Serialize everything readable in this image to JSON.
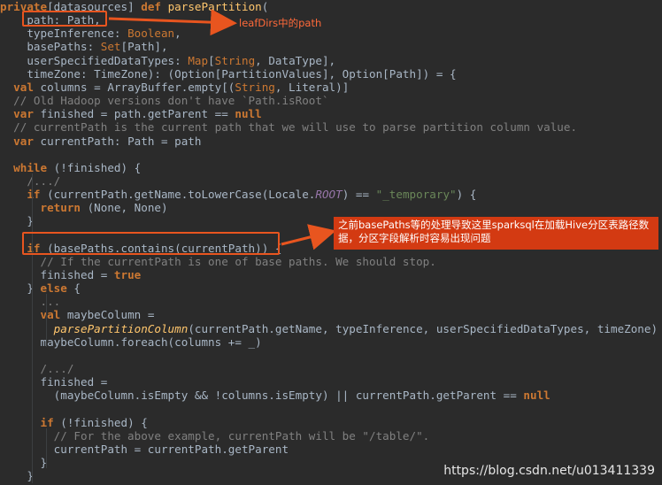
{
  "annotations": {
    "label1": "leafDirs中的path",
    "label2": "之前basePaths等的处理导致这里sparksql在加载Hive分区表路径数据，分区字段解析时容易出现问题"
  },
  "watermark": "https://blog.csdn.net/u013411339",
  "colors": {
    "background": "#2b2b2b",
    "keyword": "#cc7832",
    "comment": "#808080",
    "string": "#6a8759",
    "function": "#ffc66d",
    "constant": "#9876aa",
    "highlight": "#e8551f"
  },
  "code_lines": [
    [
      [
        "kw",
        "private"
      ],
      [
        "plain",
        "["
      ],
      [
        "plain",
        "datasources"
      ],
      [
        "plain",
        "] "
      ],
      [
        "kw",
        "def "
      ],
      [
        "fn2",
        "parsePartition"
      ],
      [
        "plain",
        "("
      ]
    ],
    [
      [
        "plain",
        "    path: Path,"
      ]
    ],
    [
      [
        "plain",
        "    typeInference: "
      ],
      [
        "type",
        "Boolean"
      ],
      [
        "plain",
        ","
      ]
    ],
    [
      [
        "plain",
        "    basePaths: "
      ],
      [
        "type",
        "Set"
      ],
      [
        "plain",
        "[Path],"
      ]
    ],
    [
      [
        "plain",
        "    userSpecifiedDataTypes: "
      ],
      [
        "type",
        "Map"
      ],
      [
        "plain",
        "["
      ],
      [
        "type",
        "String"
      ],
      [
        "plain",
        ", DataType],"
      ]
    ],
    [
      [
        "plain",
        "    timeZone: TimeZone): (Option[PartitionValues], Option[Path]) = {"
      ]
    ],
    [
      [
        "kw",
        "  val "
      ],
      [
        "plain",
        "columns = ArrayBuffer.empty[("
      ],
      [
        "type",
        "String"
      ],
      [
        "plain",
        ", Literal)]"
      ]
    ],
    [
      [
        "com",
        "  // Old Hadoop versions don't have `Path.isRoot`"
      ]
    ],
    [
      [
        "kw",
        "  var "
      ],
      [
        "plain",
        "finished = path.getParent == "
      ],
      [
        "kw",
        "null"
      ]
    ],
    [
      [
        "com",
        "  // currentPath is the current path that we will use to parse partition column value."
      ]
    ],
    [
      [
        "kw",
        "  var "
      ],
      [
        "plain",
        "currentPath: Path = path"
      ]
    ],
    [
      [
        "plain",
        ""
      ]
    ],
    [
      [
        "kw",
        "  while "
      ],
      [
        "plain",
        "(!finished) {"
      ]
    ],
    [
      [
        "com",
        "    /.../"
      ]
    ],
    [
      [
        "kw",
        "    if "
      ],
      [
        "plain",
        "(currentPath.getName.toLowerCase(Locale."
      ],
      [
        "const",
        "ROOT"
      ],
      [
        "plain",
        ") == "
      ],
      [
        "str",
        "\"_temporary\""
      ],
      [
        "plain",
        ") {"
      ]
    ],
    [
      [
        "kw",
        "      return "
      ],
      [
        "plain",
        "(None, None)"
      ]
    ],
    [
      [
        "plain",
        "    }"
      ]
    ],
    [
      [
        "plain",
        ""
      ]
    ],
    [
      [
        "kw",
        "    if "
      ],
      [
        "plain",
        "(basePaths.contains(currentPath)) {"
      ]
    ],
    [
      [
        "com",
        "      // If the currentPath is one of base paths. We should stop."
      ]
    ],
    [
      [
        "plain",
        "      finished = "
      ],
      [
        "kw",
        "true"
      ]
    ],
    [
      [
        "plain",
        "    } "
      ],
      [
        "kw",
        "else "
      ],
      [
        "plain",
        "{"
      ]
    ],
    [
      [
        "com",
        "      ..."
      ]
    ],
    [
      [
        "kw",
        "      val "
      ],
      [
        "plain",
        "maybeColumn ="
      ]
    ],
    [
      [
        "fn",
        "        parsePartitionColumn"
      ],
      [
        "plain",
        "(currentPath.getName, typeInference, userSpecifiedDataTypes, timeZone)"
      ]
    ],
    [
      [
        "plain",
        "      maybeColumn.foreach(columns += _)"
      ]
    ],
    [
      [
        "plain",
        ""
      ]
    ],
    [
      [
        "com",
        "      /.../"
      ]
    ],
    [
      [
        "plain",
        "      finished ="
      ]
    ],
    [
      [
        "plain",
        "        (maybeColumn.isEmpty && !columns.isEmpty) || currentPath.getParent == "
      ],
      [
        "kw",
        "null"
      ]
    ],
    [
      [
        "plain",
        ""
      ]
    ],
    [
      [
        "kw",
        "      if "
      ],
      [
        "plain",
        "(!finished) {"
      ]
    ],
    [
      [
        "com",
        "        // For the above example, currentPath will be \"/table/\"."
      ]
    ],
    [
      [
        "plain",
        "        currentPath = currentPath.getParent"
      ]
    ],
    [
      [
        "plain",
        "      }"
      ]
    ],
    [
      [
        "plain",
        "    }"
      ]
    ]
  ]
}
